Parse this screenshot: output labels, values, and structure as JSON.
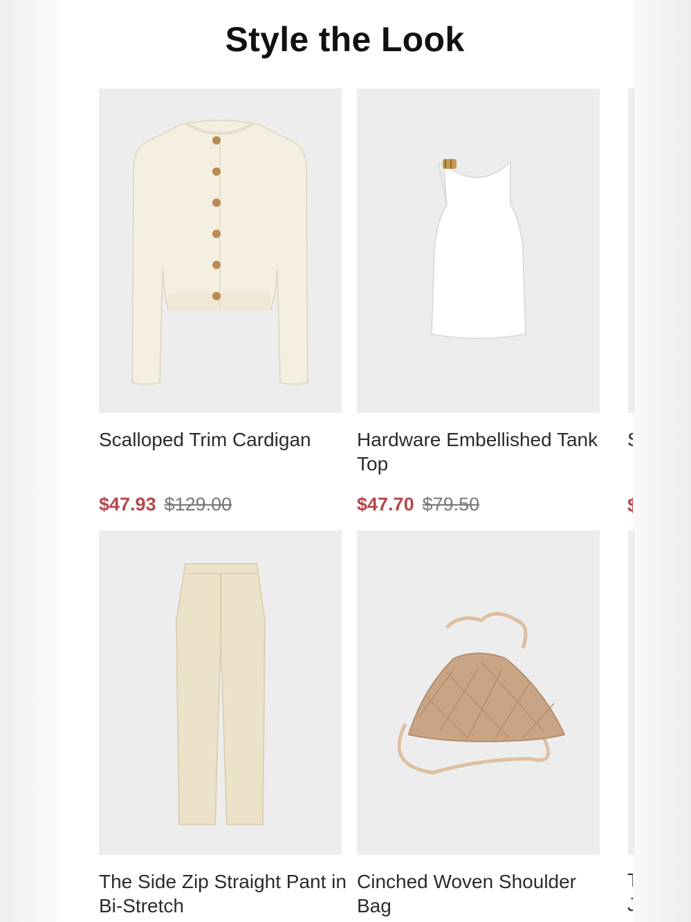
{
  "section": {
    "title": "Style the Look"
  },
  "products": [
    {
      "name": "Scalloped Trim Cardigan",
      "sale_price": "$47.93",
      "original_price": "$129.00",
      "image_icon": "cardigan-icon"
    },
    {
      "name": "Hardware Embellished Tank Top",
      "sale_price": "$47.70",
      "original_price": "$79.50",
      "image_icon": "tank-top-icon"
    },
    {
      "name": "The Side Zip Straight Pant in Bi-Stretch",
      "image_icon": "pants-icon"
    },
    {
      "name": "Cinched Woven Shoulder Bag",
      "image_icon": "shoulder-bag-icon"
    }
  ],
  "peek": {
    "row1_letter": "S",
    "row1_price_letter": "$",
    "row2_letter1": "T",
    "row2_letter2": "J"
  },
  "colors": {
    "sale": "#b4474a",
    "image_bg": "#ededed",
    "text": "#2b2b2b"
  }
}
